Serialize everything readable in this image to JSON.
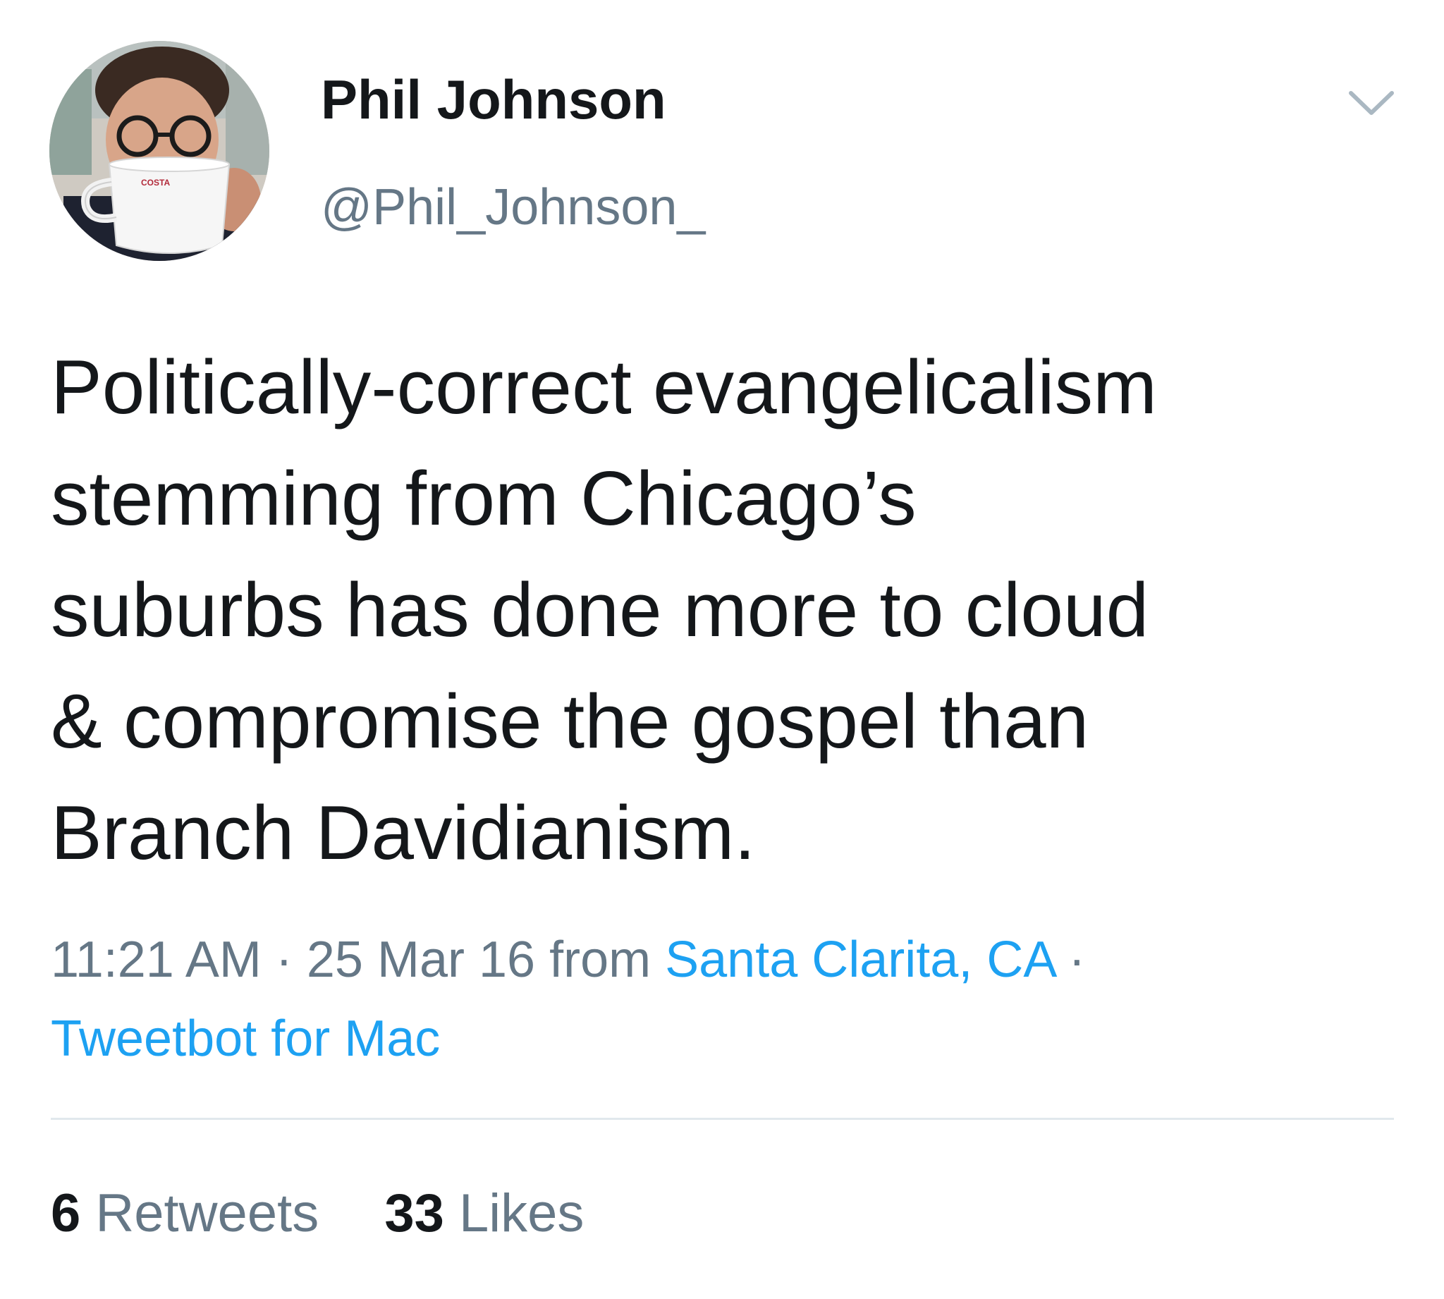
{
  "author": {
    "display_name": "Phil Johnson",
    "handle": "@Phil_Johnson_",
    "avatar_icon": "profile-photo-with-cup",
    "avatar_cup_text": "COSTA"
  },
  "tweet": {
    "text": "Politically-correct evangelicalism\nstemming from Chicago’s\nsuburbs has done more to cloud\n& compromise the gospel than\nBranch Davidianism.",
    "time": "11:21 AM",
    "separator": "·",
    "date": "25 Mar 16",
    "from_label": "from",
    "location": "Santa Clarita, CA",
    "client": "Tweetbot for Mac"
  },
  "stats": {
    "retweets_count": "6",
    "retweets_label": "Retweets",
    "likes_count": "33",
    "likes_label": "Likes"
  },
  "icons": {
    "menu": "chevron-down-icon"
  },
  "colors": {
    "text": "#14171a",
    "secondary": "#657786",
    "link": "#1da1f2",
    "divider": "#e1e8ed"
  }
}
